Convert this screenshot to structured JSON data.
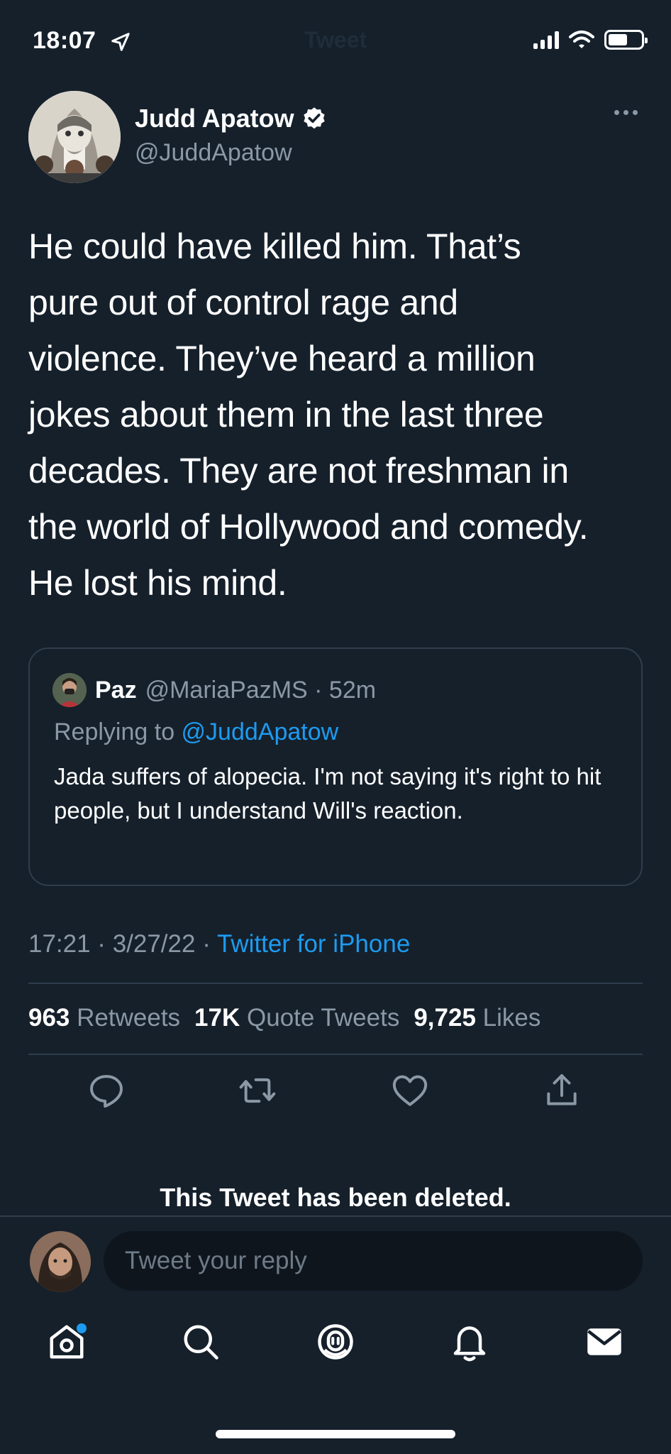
{
  "status_bar": {
    "time": "18:07",
    "ghost_title": "Tweet"
  },
  "tweet": {
    "author_name": "Judd Apatow",
    "author_handle": "@JuddApatow",
    "text": "He could have killed him.  That’s\npure out of control rage and\nviolence.    They’ve heard a million\njokes about them in the last three\ndecades.  They are not freshman in\nthe world of Hollywood and comedy.\nHe lost his mind.",
    "timestamp": "17:21 · 3/27/22 · ",
    "source": "Twitter for iPhone",
    "stats": {
      "retweets_count": "963",
      "retweets_label": "Retweets",
      "quotes_count": "17K",
      "quotes_label": "Quote Tweets",
      "likes_count": "9,725",
      "likes_label": "Likes"
    }
  },
  "quoted": {
    "name": "Paz",
    "meta": "@MariaPazMS · 52m",
    "replying_label": "Replying to ",
    "replying_handle": "@JuddApatow",
    "text": "Jada suffers of alopecia. I'm not saying it's right to hit people,  but I understand Will's reaction."
  },
  "deleted_notice": "This Tweet has been deleted.",
  "reply": {
    "placeholder": "Tweet your reply"
  },
  "icons": {
    "actions": [
      "reply-icon",
      "retweet-icon",
      "like-icon",
      "share-icon"
    ],
    "tabs": [
      "home-icon",
      "search-icon",
      "spaces-icon",
      "notifications-icon",
      "messages-icon"
    ]
  },
  "colors": {
    "background": "#15202b",
    "accent": "#1d9bf0",
    "muted": "#8b98a5",
    "border": "#2f3d4c"
  }
}
